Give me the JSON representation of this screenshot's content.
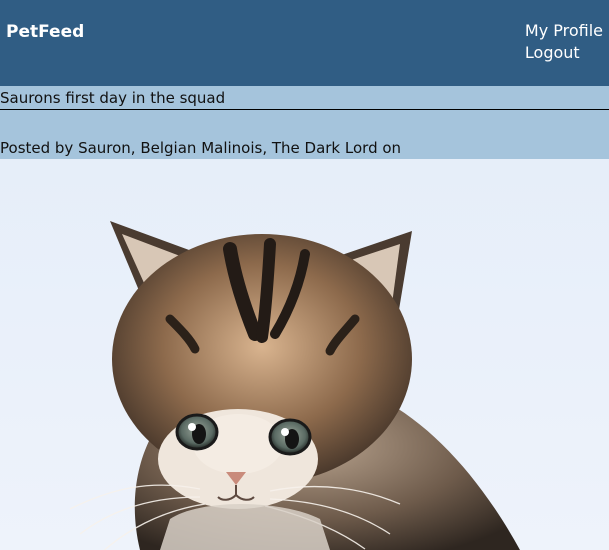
{
  "navbar": {
    "brand": "PetFeed",
    "links": [
      {
        "label": "My Profile"
      },
      {
        "label": "Logout"
      }
    ]
  },
  "post": {
    "title": "Saurons first day in the squad",
    "meta": "Posted by Sauron, Belgian Malinois, The Dark Lord on",
    "image_subject": "kitten-photo"
  },
  "colors": {
    "navbar": "#305d84",
    "post_band": "#a5c4dc",
    "image_bg": "#e6eef9"
  }
}
